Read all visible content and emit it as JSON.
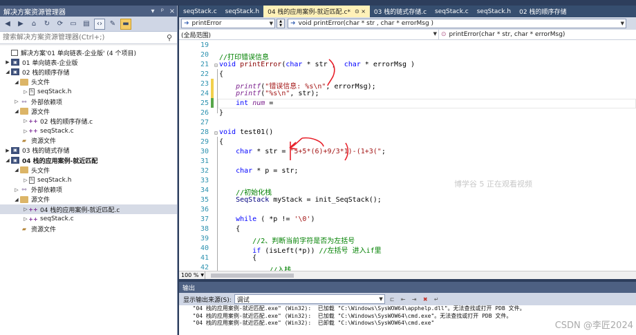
{
  "solution_explorer": {
    "title": "解决方案资源管理器",
    "title_buttons": [
      "▾",
      "ᵖ",
      "×"
    ],
    "toolbar_icons": [
      "back-icon",
      "forward-icon",
      "home-icon",
      "sync-icon",
      "refresh-icon",
      "collapse-icon",
      "properties-icon",
      "code-view-icon",
      "wrench-icon",
      "pin-icon"
    ],
    "search_placeholder": "搜索解决方案资源管理器(Ctrl+;)",
    "tree": [
      {
        "level": 0,
        "arrow": "",
        "icon": "sln",
        "label": "解决方案'01 单向链表-企业版' (4 个项目)",
        "bold": false
      },
      {
        "level": 0,
        "arrow": "▶",
        "icon": "proj",
        "label": "01 单向链表-企业版",
        "bold": false
      },
      {
        "level": 0,
        "arrow": "◢",
        "icon": "proj",
        "label": "02 栈的顺序存储",
        "bold": false
      },
      {
        "level": 1,
        "arrow": "◢",
        "icon": "folder",
        "label": "头文件",
        "bold": false
      },
      {
        "level": 2,
        "arrow": "▷",
        "icon": "hfile",
        "label": "seqStack.h",
        "bold": false
      },
      {
        "level": 1,
        "arrow": "▷",
        "icon": "ext",
        "label": "外部依赖项",
        "bold": false
      },
      {
        "level": 1,
        "arrow": "◢",
        "icon": "folder",
        "label": "源文件",
        "bold": false
      },
      {
        "level": 2,
        "arrow": "▷",
        "icon": "cfile",
        "label": "02 栈的顺序存储.c",
        "bold": false
      },
      {
        "level": 2,
        "arrow": "▷",
        "icon": "cfile",
        "label": "seqStack.c",
        "bold": false
      },
      {
        "level": 1,
        "arrow": "",
        "icon": "res",
        "label": "资源文件",
        "bold": false
      },
      {
        "level": 0,
        "arrow": "▶",
        "icon": "proj",
        "label": "03 栈的链式存储",
        "bold": false
      },
      {
        "level": 0,
        "arrow": "◢",
        "icon": "proj",
        "label": "04 栈的应用案例-就近匹配",
        "bold": true
      },
      {
        "level": 1,
        "arrow": "◢",
        "icon": "folder",
        "label": "头文件",
        "bold": false
      },
      {
        "level": 2,
        "arrow": "▷",
        "icon": "hfile",
        "label": "seqStack.h",
        "bold": false
      },
      {
        "level": 1,
        "arrow": "▷",
        "icon": "ext",
        "label": "外部依赖项",
        "bold": false
      },
      {
        "level": 1,
        "arrow": "◢",
        "icon": "folder",
        "label": "源文件",
        "bold": false
      },
      {
        "level": 2,
        "arrow": "▷",
        "icon": "cfile",
        "label": "04 栈的应用案例-就近匹配.c",
        "bold": false,
        "selected": true
      },
      {
        "level": 2,
        "arrow": "▷",
        "icon": "cfile",
        "label": "seqStack.c",
        "bold": false
      },
      {
        "level": 1,
        "arrow": "",
        "icon": "res",
        "label": "资源文件",
        "bold": false
      }
    ]
  },
  "tabs": [
    {
      "label": "seqStack.c",
      "active": false
    },
    {
      "label": "seqStack.h",
      "active": false
    },
    {
      "label": "04 栈的应用案例-就近匹配.c*",
      "active": true,
      "close": "⊙ ×"
    },
    {
      "label": "03 栈的链式存储.c",
      "active": false
    },
    {
      "label": "seqStack.c",
      "active": false
    },
    {
      "label": "seqStack.h",
      "active": false
    },
    {
      "label": "02 栈的顺序存储",
      "active": false
    }
  ],
  "nav": {
    "scope_combo": "printError",
    "func_combo": "void printError(char * str , char * errorMsg )",
    "range_combo": "(全局范围)",
    "member_combo": "printError(char * str, char * errorMsg)"
  },
  "editor": {
    "line_numbers": [
      "19",
      "20",
      "21",
      "22",
      "23",
      "24",
      "25",
      "26",
      "27",
      "28",
      "29",
      "30",
      "31",
      "32",
      "33",
      "34",
      "35",
      "36",
      "37",
      "38",
      "39",
      "40",
      "41",
      "42"
    ],
    "lines": [
      [],
      [
        {
          "c": "cm",
          "t": "//打印错误信息"
        }
      ],
      [
        {
          "c": "kw",
          "t": "void"
        },
        {
          "c": "",
          "t": " "
        },
        {
          "c": "fn",
          "t": "printError"
        },
        {
          "c": "",
          "t": "("
        },
        {
          "c": "kw",
          "t": "char"
        },
        {
          "c": "",
          "t": " * str ,  "
        },
        {
          "c": "kw",
          "t": "char"
        },
        {
          "c": "",
          "t": " * errorMsg )"
        }
      ],
      [
        {
          "c": "",
          "t": "{"
        }
      ],
      [
        {
          "c": "",
          "t": "    "
        },
        {
          "c": "it",
          "t": "printf"
        },
        {
          "c": "",
          "t": "("
        },
        {
          "c": "st",
          "t": "\"错误信息: %s\\n\""
        },
        {
          "c": "",
          "t": ", errorMsg);"
        }
      ],
      [
        {
          "c": "",
          "t": "    "
        },
        {
          "c": "it",
          "t": "printf"
        },
        {
          "c": "",
          "t": "("
        },
        {
          "c": "st",
          "t": "\"%s\\n\""
        },
        {
          "c": "",
          "t": ", str);"
        }
      ],
      [
        {
          "c": "",
          "t": "    "
        },
        {
          "c": "kw",
          "t": "int"
        },
        {
          "c": "",
          "t": " "
        },
        {
          "c": "it",
          "t": "num"
        },
        {
          "c": "",
          "t": " = "
        }
      ],
      [
        {
          "c": "",
          "t": "}"
        }
      ],
      [],
      [
        {
          "c": "kw",
          "t": "void"
        },
        {
          "c": "",
          "t": " test01()"
        }
      ],
      [
        {
          "c": "",
          "t": "{"
        }
      ],
      [
        {
          "c": "",
          "t": "    "
        },
        {
          "c": "kw",
          "t": "char"
        },
        {
          "c": "",
          "t": " * str = "
        },
        {
          "c": "st",
          "t": "\"5+5*(6)+9/3*1)-(1+3(\""
        },
        {
          "c": "",
          "t": ";"
        }
      ],
      [],
      [
        {
          "c": "",
          "t": "    "
        },
        {
          "c": "kw",
          "t": "char"
        },
        {
          "c": "",
          "t": " * p = str;"
        }
      ],
      [],
      [
        {
          "c": "",
          "t": "    "
        },
        {
          "c": "cm",
          "t": "//初始化栈"
        }
      ],
      [
        {
          "c": "",
          "t": "    "
        },
        {
          "c": "nm",
          "t": "SeqStack"
        },
        {
          "c": "",
          "t": " myStack = init_SeqStack();"
        }
      ],
      [],
      [
        {
          "c": "",
          "t": "    "
        },
        {
          "c": "kw",
          "t": "while"
        },
        {
          "c": "",
          "t": " ( *p != "
        },
        {
          "c": "st",
          "t": "'\\0'"
        },
        {
          "c": "",
          "t": ")"
        }
      ],
      [
        {
          "c": "",
          "t": "    {"
        }
      ],
      [
        {
          "c": "",
          "t": "        "
        },
        {
          "c": "cm",
          "t": "//2、判断当前字符是否为左括号"
        }
      ],
      [
        {
          "c": "",
          "t": "        "
        },
        {
          "c": "kw",
          "t": "if"
        },
        {
          "c": "",
          "t": " (isLeft(*p)) "
        },
        {
          "c": "cm",
          "t": "//左括号 进入if里"
        }
      ],
      [
        {
          "c": "",
          "t": "        {"
        }
      ],
      [
        {
          "c": "",
          "t": "            "
        },
        {
          "c": "cm",
          "t": "//入栈"
        }
      ]
    ],
    "watermark": "博学谷          5 正在观看视频"
  },
  "zoom": "100 %",
  "output": {
    "title": "输出",
    "source_label": "显示输出来源(S):",
    "source_value": "调试",
    "lines": [
      "  \"04 栈的应用案例-就近匹配.exe\" (Win32):  已加载 \"C:\\Windows\\SysWOW64\\apphelp.dll\"。无法查找或打开 PDB 文件。",
      "  \"04 栈的应用案例-就近匹配.exe\" (Win32):  已加载 \"C:\\Windows\\SysWOW64\\cmd.exe\"。无法查找或打开 PDB 文件。",
      "  \"04 栈的应用案例-就近匹配.exe\" (Win32):  已卸载 \"C:\\Windows\\SysWOW64\\cmd.exe\""
    ],
    "watermark": "CSDN @李匠2024"
  },
  "colors": {
    "frame": "#2d3e5c",
    "panel_title": "#4d6082",
    "tab_active": "#fff1b8",
    "annotation_red": "#e8202a",
    "change_yellow": "#f2d04c",
    "change_green": "#57a64a"
  }
}
